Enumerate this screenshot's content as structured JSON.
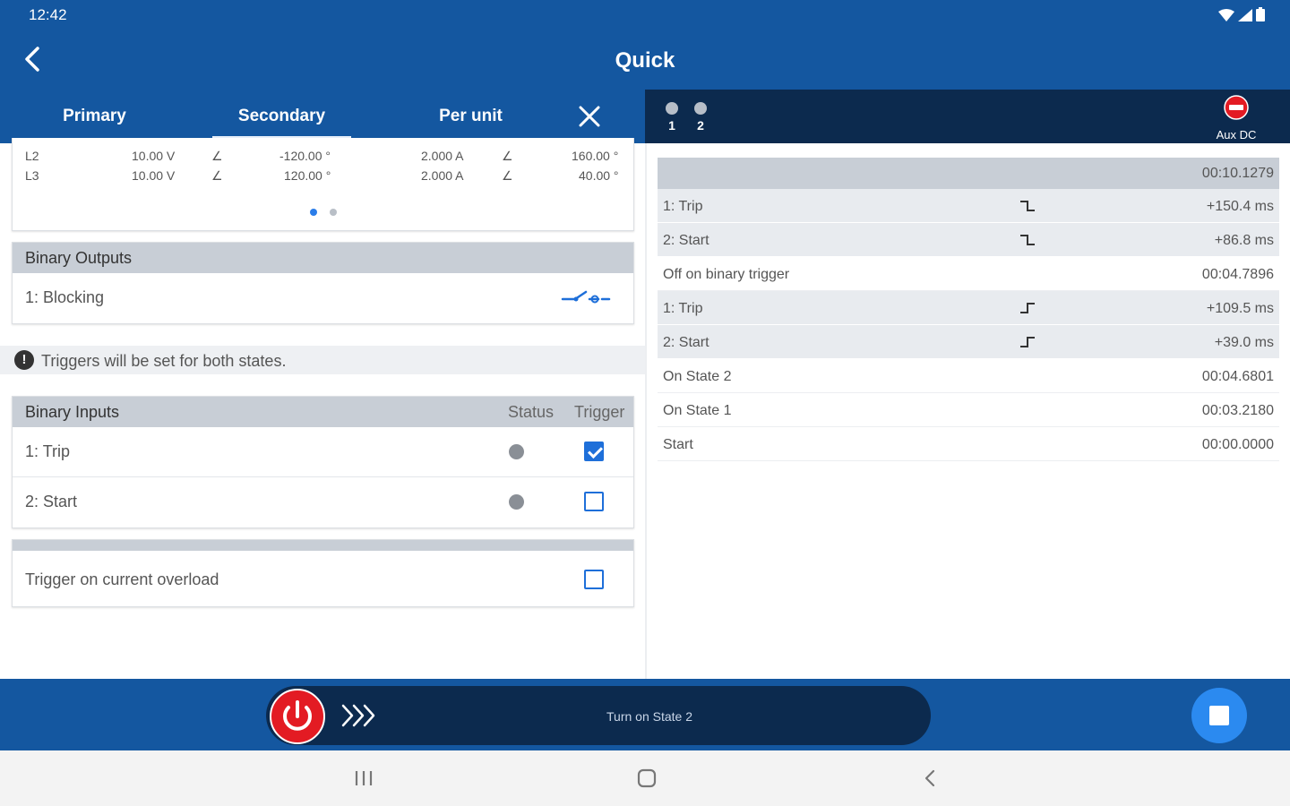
{
  "status_bar": {
    "time": "12:42"
  },
  "app_bar": {
    "title": "Quick"
  },
  "tabs": [
    {
      "label": "Primary",
      "active": false
    },
    {
      "label": "Secondary",
      "active": true
    },
    {
      "label": "Per unit",
      "active": false
    }
  ],
  "phasor_rows": [
    {
      "phase": "L2",
      "voltage": "10.00 V",
      "v_angle": "-120.00 °",
      "current": "2.000 A",
      "i_angle": "160.00 °"
    },
    {
      "phase": "L3",
      "voltage": "10.00 V",
      "v_angle": "120.00 °",
      "current": "2.000 A",
      "i_angle": "40.00 °"
    }
  ],
  "states": [
    {
      "number": "1"
    },
    {
      "number": "2"
    }
  ],
  "aux_dc": {
    "label": "Aux DC"
  },
  "binary_outputs": {
    "title": "Binary Outputs",
    "items": [
      {
        "label": "1: Blocking"
      }
    ]
  },
  "trigger_note": {
    "icon": "!",
    "text": "Triggers will be set for both states."
  },
  "binary_inputs": {
    "title": "Binary Inputs",
    "status_header": "Status",
    "trigger_header": "Trigger",
    "items": [
      {
        "label": "1: Trip",
        "trigger": true
      },
      {
        "label": "2: Start",
        "trigger": false
      }
    ]
  },
  "overload": {
    "label": "Trigger on current overload",
    "checked": false
  },
  "event_log": {
    "total_time": "00:10.1279",
    "rows": [
      {
        "name": "1: Trip",
        "value": "+150.4 ms",
        "edge": "falling",
        "shaded": true
      },
      {
        "name": "2: Start",
        "value": "+86.8 ms",
        "edge": "falling",
        "shaded": true
      },
      {
        "name": "Off on binary trigger",
        "value": "00:04.7896",
        "edge": "",
        "shaded": false
      },
      {
        "name": "1: Trip",
        "value": "+109.5 ms",
        "edge": "rising",
        "shaded": true
      },
      {
        "name": "2: Start",
        "value": "+39.0 ms",
        "edge": "rising",
        "shaded": true
      },
      {
        "name": "On State 2",
        "value": "00:04.6801",
        "edge": "",
        "shaded": false
      },
      {
        "name": "On State 1",
        "value": "00:03.2180",
        "edge": "",
        "shaded": false
      },
      {
        "name": "Start",
        "value": "00:00.0000",
        "edge": "",
        "shaded": false
      }
    ]
  },
  "control": {
    "slider_label": "Turn on State 2"
  },
  "colors": {
    "brand": "#1457a0",
    "dark": "#0c2a4e",
    "power": "#e31b23",
    "accent": "#2b8af0",
    "check": "#1e6fd9"
  }
}
